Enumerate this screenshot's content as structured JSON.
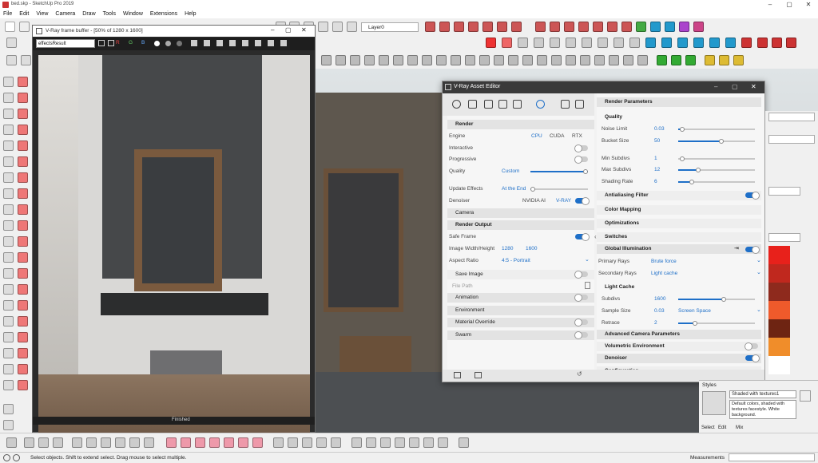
{
  "app": {
    "window_title": "bed.skp - SketchUp Pro 2019"
  },
  "menu": [
    "File",
    "Edit",
    "View",
    "Camera",
    "Draw",
    "Tools",
    "Window",
    "Extensions",
    "Help"
  ],
  "layer_select": {
    "value": "Layer0"
  },
  "frame_buffer": {
    "title": "V-Ray frame buffer - [50% of 1280 x 1600]",
    "channel": "effectsResult",
    "channel_buttons": [
      "R",
      "G",
      "B"
    ],
    "status": "Finished"
  },
  "asset_editor": {
    "title": "V-Ray Asset Editor",
    "left": {
      "render_section": "Render",
      "engine_label": "Engine",
      "engine_options": [
        "CPU",
        "CUDA",
        "RTX"
      ],
      "interactive_label": "Interactive",
      "progressive_label": "Progressive",
      "quality_label": "Quality",
      "quality_value": "Custom",
      "update_effects_label": "Update Effects",
      "update_effects_value": "At the End",
      "denoiser_label": "Denoiser",
      "denoiser_options": [
        "NVIDIA AI",
        "V-RAY"
      ],
      "camera_section": "Camera",
      "render_output_section": "Render Output",
      "safe_frame_label": "Safe Frame",
      "image_wh_label": "Image Width/Height",
      "image_width": "1280",
      "image_height": "1600",
      "aspect_ratio_label": "Aspect Ratio",
      "aspect_ratio_value": "4:5 - Portrait",
      "save_image_label": "Save Image",
      "file_path_label": "File Path",
      "animation_section": "Animation",
      "environment_section": "Environment",
      "material_override_section": "Material Override",
      "swarm_section": "Swarm"
    },
    "right": {
      "render_parameters": "Render Parameters",
      "quality_section": "Quality",
      "noise_limit_label": "Noise Limit",
      "noise_limit_value": "0.03",
      "bucket_size_label": "Bucket Size",
      "bucket_size_value": "50",
      "min_subdivs_label": "Min Subdivs",
      "min_subdivs_value": "1",
      "max_subdivs_label": "Max Subdivs",
      "max_subdivs_value": "12",
      "shading_rate_label": "Shading Rate",
      "shading_rate_value": "6",
      "antialiasing_filter": "Antialiasing Filter",
      "color_mapping": "Color Mapping",
      "optimizations": "Optimizations",
      "switches": "Switches",
      "global_illumination": "Global Illumination",
      "primary_rays_label": "Primary Rays",
      "primary_rays_value": "Brute force",
      "secondary_rays_label": "Secondary Rays",
      "secondary_rays_value": "Light cache",
      "light_cache": "Light Cache",
      "subdivs_label": "Subdivs",
      "subdivs_value": "1600",
      "sample_size_label": "Sample Size",
      "sample_size_value": "0.03",
      "screen_space_value": "Screen Space",
      "retrace_label": "Retrace",
      "retrace_value": "2",
      "advanced_camera": "Advanced Camera Parameters",
      "volumetric_environment": "Volumetric Environment",
      "denoiser": "Denoiser",
      "configuration": "Configuration"
    }
  },
  "styles_panel": {
    "header": "Styles",
    "style_name": "Shaded with textures1",
    "description": "Default colors, shaded with textures facestyle. White background.",
    "tabs": [
      "Select",
      "Edit",
      "Mix"
    ]
  },
  "swatch_colors": [
    "#e8211b",
    "#c0281e",
    "#8e2a1d",
    "#ef5a2b",
    "#6e2412",
    "#f08d2a",
    "#ffffff"
  ],
  "status": {
    "hint": "Select objects. Shift to extend select. Drag mouse to select multiple.",
    "measurements_label": "Measurements"
  }
}
